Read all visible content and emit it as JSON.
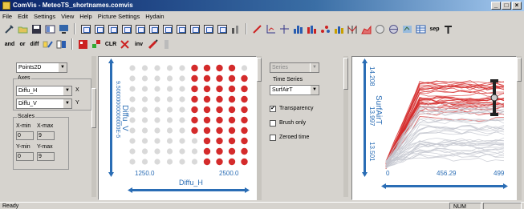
{
  "window": {
    "title": "ComVis - MeteoTS_shortnames.comvis"
  },
  "menu": [
    "File",
    "Edit",
    "Settings",
    "View",
    "Help",
    "Picture Settings",
    "Hydain"
  ],
  "toolbar": {
    "row2_labels": [
      "and",
      "or",
      "diff",
      "CLR",
      "inv"
    ]
  },
  "scatter_panel": {
    "view_type": "Points2D",
    "axes_label": "Axes",
    "x_axis": "Diffu_H",
    "y_axis": "Diffu_V",
    "x_letter": "X",
    "y_letter": "Y",
    "scales_label": "Scales",
    "xmin_label": "X-min",
    "xmax_label": "X-max",
    "xmin": "0",
    "xmax": "9",
    "ymin_label": "Y-min",
    "ymax_label": "Y-max",
    "ymin": "0",
    "ymax": "9"
  },
  "scatter_plot": {
    "x_label": "Diffu_H",
    "y_label": "Diffu_V",
    "x_tick_left": "1250.0",
    "x_tick_right": "2500.0",
    "y_tick_top": "9.50000000000000E-5",
    "y_tick_bottom": "0000000000E-5",
    "colors": {
      "selected": "#d42b2b",
      "unselected": "#d9d9d9",
      "axis": "#2a6db5"
    }
  },
  "ts_panel": {
    "view_type": "Series",
    "time_series_label": "Time Series",
    "series": "SurfAirT",
    "transparency_label": "Transparency",
    "transparency_checked": "✔",
    "brush_only_label": "Brush only",
    "zeroed_time_label": "Zeroed time"
  },
  "ts_plot": {
    "y_label": "SurfAirT",
    "y_ticks": [
      "14.208",
      "13.997",
      "13.501"
    ],
    "x_ticks": [
      "0",
      "456.29",
      "499"
    ]
  },
  "status": {
    "text": "Ready",
    "right": "NUM"
  }
}
